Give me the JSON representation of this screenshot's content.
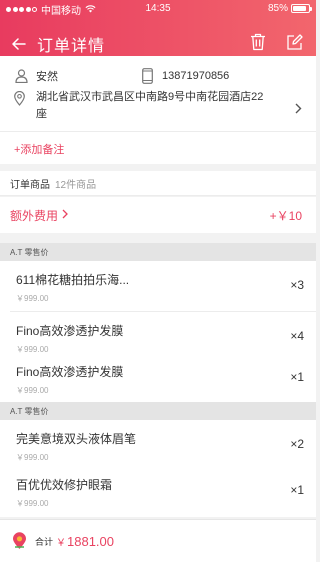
{
  "status_bar": {
    "carrier": "中国移动",
    "time": "14:35",
    "battery": "85%",
    "battery_level": 0.85
  },
  "nav": {
    "title": "订单详情"
  },
  "contact": {
    "name": "安然",
    "phone": "13871970856",
    "address": "湖北省武汉市武昌区中南路9号中南花园酒店22座"
  },
  "add_note_label": "+添加备注",
  "goods_header": {
    "label": "订单商品",
    "count": "12件商品"
  },
  "extra_fee": {
    "label": "额外费用",
    "amount": "+￥10"
  },
  "sections": [
    {
      "title": "A.T 零售价",
      "items": [
        {
          "name": "611棉花糖拍拍乐海...",
          "price": "￥999.00",
          "qty": "×3"
        },
        {
          "name": "Fino高效渗透护发膜",
          "price": "￥999.00",
          "qty": "×4"
        },
        {
          "name": "Fino高效渗透护发膜",
          "price": "￥999.00",
          "qty": "×1"
        }
      ]
    },
    {
      "title": "A.T 零售价",
      "items": [
        {
          "name": "完美意境双头液体眉笔",
          "price": "￥999.00",
          "qty": "×2"
        },
        {
          "name": "百优优效修护眼霜",
          "price": "￥999.00",
          "qty": "×1"
        }
      ]
    }
  ],
  "footer": {
    "label": "合计",
    "currency": "￥",
    "total": "1881.00"
  },
  "colors": {
    "accent": "#e94361",
    "header_start": "#e83b5f",
    "header_end": "#f2666d"
  }
}
